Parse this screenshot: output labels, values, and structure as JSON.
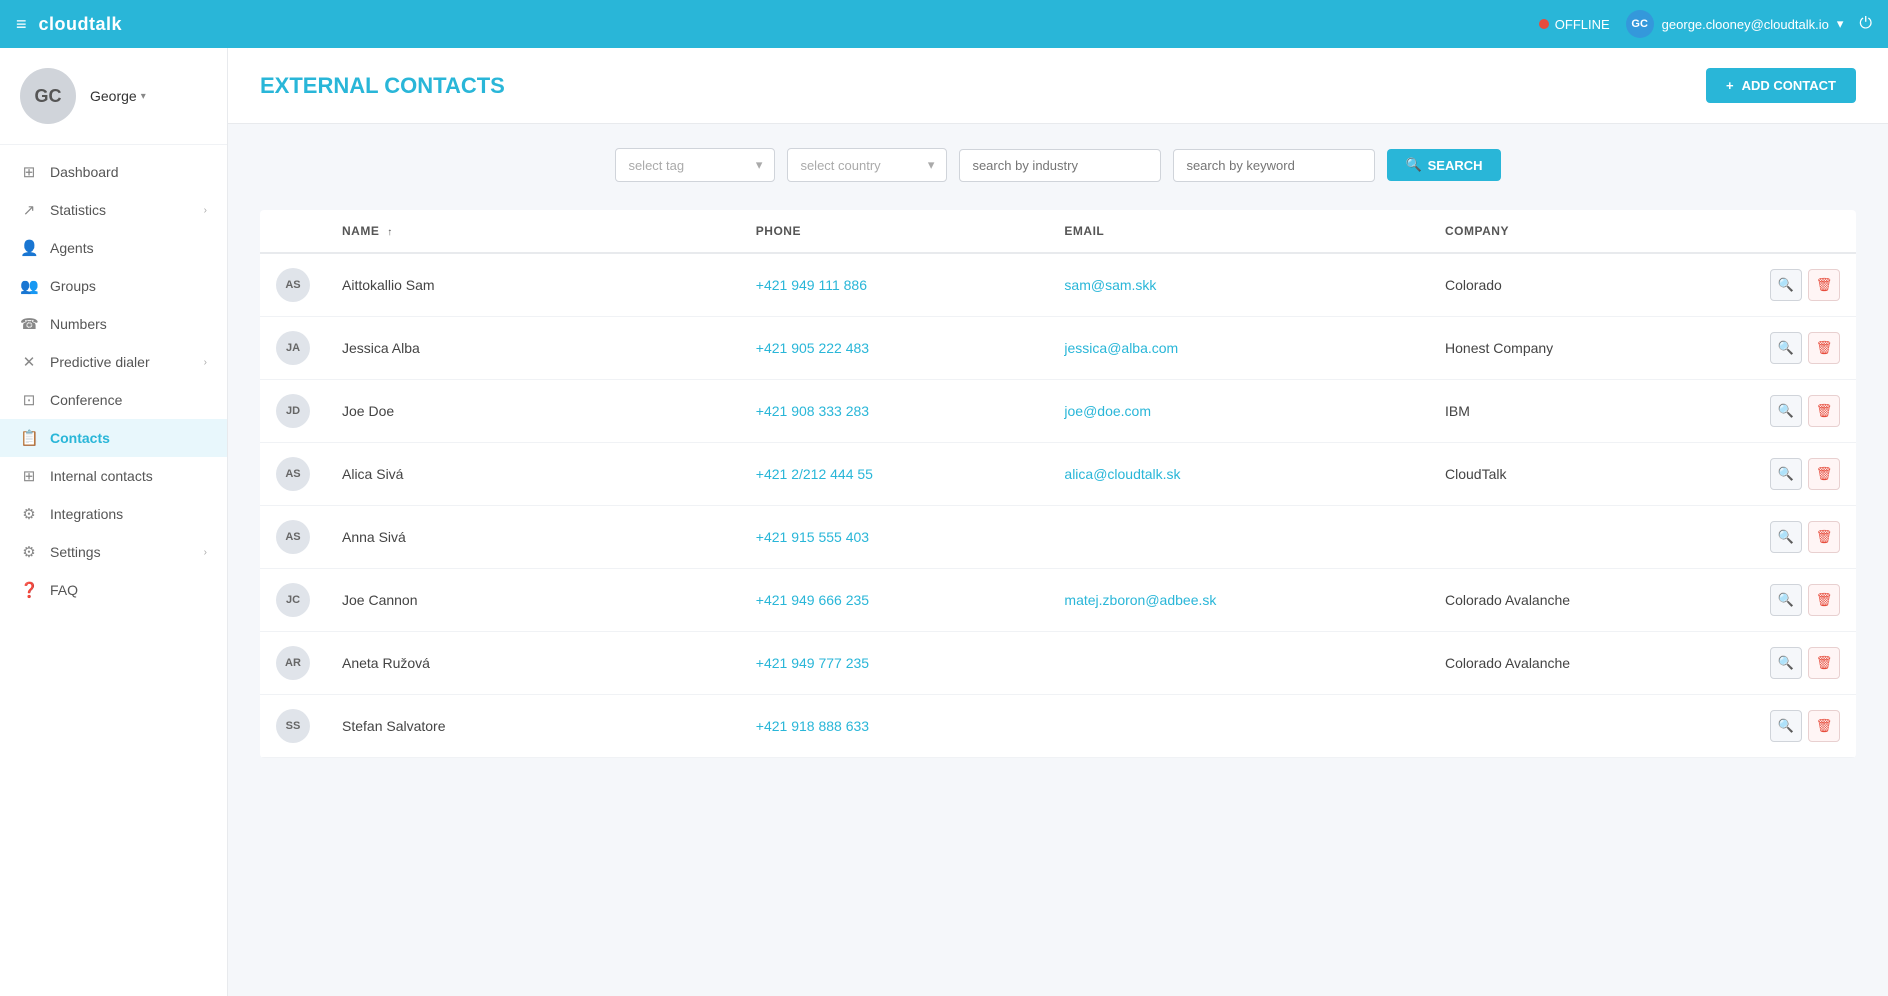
{
  "app": {
    "brand": "cloudtalk",
    "hamburger_icon": "≡"
  },
  "topnav": {
    "status_label": "OFFLINE",
    "user_email": "george.clooney@cloudtalk.io",
    "user_initials": "GC",
    "chevron": "▾",
    "power_icon": "⏻"
  },
  "sidebar": {
    "profile_initials": "GC",
    "profile_name": "George",
    "profile_chevron": "▾",
    "nav_items": [
      {
        "id": "dashboard",
        "label": "Dashboard",
        "icon": "⊞",
        "has_chevron": false
      },
      {
        "id": "statistics",
        "label": "Statistics",
        "icon": "↗",
        "has_chevron": true
      },
      {
        "id": "agents",
        "label": "Agents",
        "icon": "👤",
        "has_chevron": false
      },
      {
        "id": "groups",
        "label": "Groups",
        "icon": "👥",
        "has_chevron": false
      },
      {
        "id": "numbers",
        "label": "Numbers",
        "icon": "☎",
        "has_chevron": false
      },
      {
        "id": "predictive_dialer",
        "label": "Predictive dialer",
        "icon": "✕",
        "has_chevron": true
      },
      {
        "id": "conference",
        "label": "Conference",
        "icon": "⊡",
        "has_chevron": false
      },
      {
        "id": "contacts",
        "label": "Contacts",
        "icon": "📋",
        "has_chevron": false,
        "active": true
      },
      {
        "id": "internal_contacts",
        "label": "Internal contacts",
        "icon": "⊞",
        "has_chevron": false
      },
      {
        "id": "integrations",
        "label": "Integrations",
        "icon": "⚙",
        "has_chevron": false
      },
      {
        "id": "settings",
        "label": "Settings",
        "icon": "⚙",
        "has_chevron": true
      },
      {
        "id": "faq",
        "label": "FAQ",
        "icon": "❓",
        "has_chevron": false
      }
    ]
  },
  "page": {
    "title": "EXTERNAL CONTACTS",
    "add_contact_label": "ADD CONTACT",
    "add_icon": "+"
  },
  "filters": {
    "tag_placeholder": "select tag",
    "country_placeholder": "select country",
    "industry_placeholder": "search by industry",
    "keyword_placeholder": "search by keyword",
    "search_label": "SEARCH",
    "search_icon": "🔍",
    "dropdown_arrow": "▾"
  },
  "table": {
    "columns": [
      {
        "id": "name",
        "label": "NAME",
        "sort_icon": "↑"
      },
      {
        "id": "phone",
        "label": "PHONE"
      },
      {
        "id": "email",
        "label": "EMAIL"
      },
      {
        "id": "company",
        "label": "COMPANY"
      }
    ],
    "rows": [
      {
        "initials": "AS",
        "name": "Aittokallio Sam",
        "phone": "+421 949 111 886",
        "email": "sam@sam.skk",
        "company": "Colorado"
      },
      {
        "initials": "JA",
        "name": "Jessica Alba",
        "phone": "+421 905 222 483",
        "email": "jessica@alba.com",
        "company": "Honest Company"
      },
      {
        "initials": "JD",
        "name": "Joe Doe",
        "phone": "+421 908 333 283",
        "email": "joe@doe.com",
        "company": "IBM"
      },
      {
        "initials": "AS",
        "name": "Alica Sivá",
        "phone": "+421 2/212 444 55",
        "email": "alica@cloudtalk.sk",
        "company": "CloudTalk"
      },
      {
        "initials": "AS",
        "name": "Anna Sivá",
        "phone": "+421 915 555 403",
        "email": "",
        "company": ""
      },
      {
        "initials": "JC",
        "name": "Joe Cannon",
        "phone": "+421 949 666 235",
        "email": "matej.zboron@adbee.sk",
        "company": "Colorado Avalanche"
      },
      {
        "initials": "AR",
        "name": "Aneta Ružová",
        "phone": "+421 949 777 235",
        "email": "",
        "company": "Colorado Avalanche"
      },
      {
        "initials": "SS",
        "name": "Stefan Salvatore",
        "phone": "+421 918 888 633",
        "email": "",
        "company": ""
      }
    ],
    "view_icon": "🔍",
    "delete_icon": "🗑"
  }
}
